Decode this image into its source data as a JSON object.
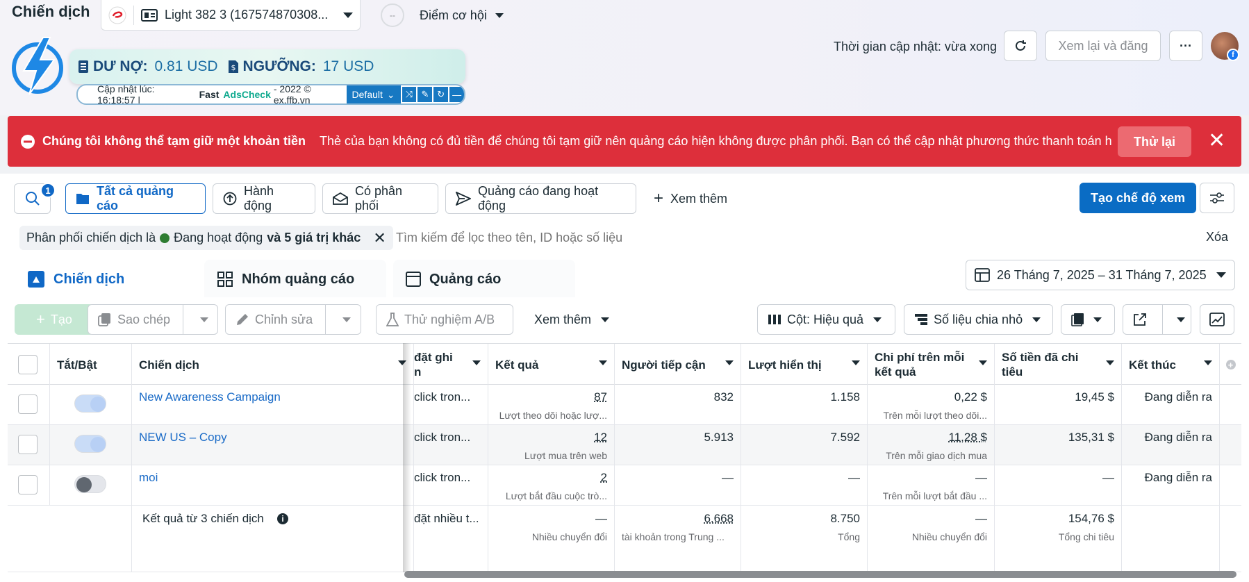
{
  "header": {
    "page_title": "Chiến dịch",
    "account_name": "Light 382 3 (167574870308...",
    "opportunity_label": "Điểm cơ hội",
    "opportunity_score": "--",
    "update_time": "Thời gian cập nhật: vừa xong",
    "review_publish": "Xem lại và đăng"
  },
  "adscheck": {
    "debt_label": "DƯ NỢ:",
    "debt_value": "0.81 USD",
    "threshold_label": "NGƯỠNG:",
    "threshold_value": "17 USD",
    "updated_text": "Cập nhật lúc: 16:18:57 |",
    "brand_fast": "Fast",
    "brand_ads": "AdsCheck",
    "copyright": "- 2022 © ex.ffb.vn",
    "preset": "Default"
  },
  "alert": {
    "title": "Chúng tôi không thể tạm giữ một khoản tiền",
    "message": "Thẻ của bạn không có đủ tiền để chúng tôi tạm giữ nên quảng cáo hiện không được phân phối. Bạn có thể cập nhật phương thức thanh toán hoặ...",
    "retry": "Thử lại"
  },
  "filters": {
    "badge": "1",
    "all_ads": "Tất cả quảng cáo",
    "actions": "Hành động",
    "delivering": "Có phân phối",
    "active_ads": "Quảng cáo đang hoạt động",
    "see_more": "Xem thêm",
    "create_view": "Tạo chế độ xem"
  },
  "search": {
    "chip_prefix": "Phân phối chiến dịch là",
    "chip_status": "Đang hoạt động",
    "chip_suffix": "và 5 giá trị khác",
    "placeholder": "Tìm kiếm để lọc theo tên, ID hoặc số liệu",
    "clear": "Xóa"
  },
  "tabs": {
    "campaigns": "Chiến dịch",
    "adsets": "Nhóm quảng cáo",
    "ads": "Quảng cáo",
    "date_range": "26 Tháng 7, 2025 – 31 Tháng 7, 2025"
  },
  "toolbar": {
    "create": "Tạo",
    "duplicate": "Sao chép",
    "edit": "Chỉnh sửa",
    "ab_test": "Thử nghiệm A/B",
    "more": "Xem thêm",
    "columns": "Cột: Hiệu quả",
    "breakdown": "Số liệu chia nhỏ"
  },
  "table": {
    "headers": {
      "toggle": "Tắt/Bật",
      "campaign": "Chiến dịch",
      "attribution_l1": "đặt ghi",
      "attribution_l2": "n",
      "results": "Kết quả",
      "reach": "Người tiếp cận",
      "impressions": "Lượt hiển thị",
      "cpr_l1": "Chi phí trên mỗi",
      "cpr_l2": "kết quả",
      "spent_l1": "Số tiền đã chi",
      "spent_l2": "tiêu",
      "ends": "Kết thúc"
    },
    "rows": [
      {
        "name": "New Awareness Campaign",
        "on": true,
        "attribution": "click tron...",
        "result": "87",
        "result_type": "Lượt theo dõi hoặc lượ...",
        "reach": "832",
        "impressions": "1.158",
        "cpr": "0,22 $",
        "cpr_type": "Trên mỗi lượt theo dõi...",
        "spent": "19,45 $",
        "ends": "Đang diễn ra"
      },
      {
        "name": "NEW US – Copy",
        "on": true,
        "attribution": "click tron...",
        "result": "12",
        "result_type": "Lượt mua trên web",
        "reach": "5.913",
        "impressions": "7.592",
        "cpr": "11,28 $",
        "cpr_type": "Trên mỗi giao dịch mua",
        "spent": "135,31 $",
        "ends": "Đang diễn ra"
      },
      {
        "name": "moi",
        "on": false,
        "attribution": "click tron...",
        "result": "2",
        "result_type": "Lượt bắt đầu cuộc trò...",
        "reach": "—",
        "impressions": "—",
        "cpr": "—",
        "cpr_type": "Trên mỗi lượt bắt đầu ...",
        "spent": "—",
        "ends": "Đang diễn ra"
      }
    ],
    "total": {
      "label": "Kết quả từ 3 chiến dịch",
      "attribution": "đặt nhiều t...",
      "result": "—",
      "result_type": "Nhiều chuyển đổi",
      "reach": "6.668",
      "reach_type": "tài khoản trong Trung ...",
      "impressions": "8.750",
      "impressions_type": "Tổng",
      "cpr": "—",
      "cpr_type": "Nhiều chuyển đổi",
      "spent": "154,76 $",
      "spent_type": "Tổng chi tiêu"
    }
  },
  "colors": {
    "primary": "#0a6cc4",
    "alert": "#dd2f3b",
    "link": "#1a6bc7",
    "toggle_on": "#c9dcf7",
    "toggle_off": "#e4e6eb"
  }
}
